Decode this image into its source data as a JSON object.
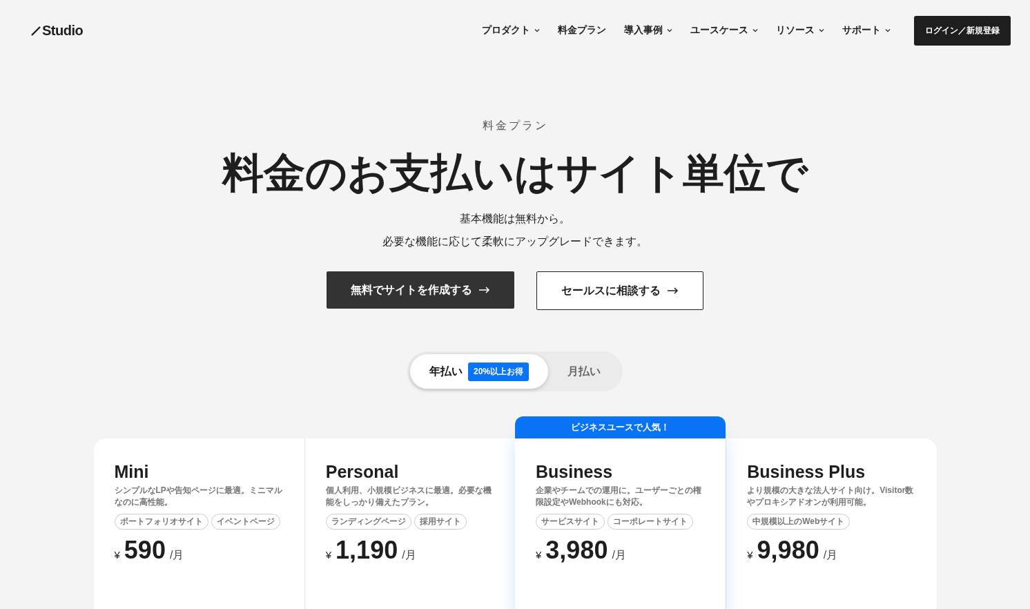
{
  "header": {
    "logo": "Studio",
    "nav": [
      {
        "label": "プロダクト",
        "has_menu": true
      },
      {
        "label": "料金プラン",
        "has_menu": false
      },
      {
        "label": "導入事例",
        "has_menu": true
      },
      {
        "label": "ユースケース",
        "has_menu": true
      },
      {
        "label": "リソース",
        "has_menu": true
      },
      {
        "label": "サポート",
        "has_menu": true
      }
    ],
    "login_button": "ログイン／新規登録"
  },
  "hero": {
    "eyebrow": "料金プラン",
    "title": "料金のお支払いはサイト単位で",
    "subtitle_lines": [
      "基本機能は無料から。",
      "必要な機能に応じて柔軟にアップグレードできます。"
    ],
    "buttons": [
      {
        "label": "無料でサイトを作成する",
        "kind": "primary"
      },
      {
        "label": "セールスに相談する",
        "kind": "secondary"
      }
    ]
  },
  "billing_toggle": [
    {
      "label": "年払い",
      "badge": "20%以上お得",
      "selected": true
    },
    {
      "label": "月払い",
      "selected": false
    }
  ],
  "plans": [
    {
      "name": "Mini",
      "description": "シンプルなLPや告知ページに最適。ミニマルなのに高性能。",
      "tags": [
        "ポートフォリオサイト",
        "イベントページ"
      ],
      "currency": "¥",
      "price": "590",
      "unit": "/月",
      "featured": false
    },
    {
      "name": "Personal",
      "description": "個人利用、小規模ビジネスに最適。必要な機能をしっかり備えたプラン。",
      "tags": [
        "ランディングページ",
        "採用サイト"
      ],
      "currency": "¥",
      "price": "1,190",
      "unit": "/月",
      "featured": false
    },
    {
      "name": "Business",
      "description": "企業やチームでの運用に。ユーザーごとの権限設定やWebhookにも対応。",
      "tags": [
        "サービスサイト",
        "コーポレートサイト"
      ],
      "currency": "¥",
      "price": "3,980",
      "unit": "/月",
      "featured": true,
      "badge": "ビジネスユースで人気！"
    },
    {
      "name": "Business Plus",
      "description": "より規模の大きな法人サイト向け。Visitor数やプロキシアドオンが利用可能。",
      "tags": [
        "中規模以上のWebサイト"
      ],
      "currency": "¥",
      "price": "9,980",
      "unit": "/月",
      "featured": false
    }
  ]
}
